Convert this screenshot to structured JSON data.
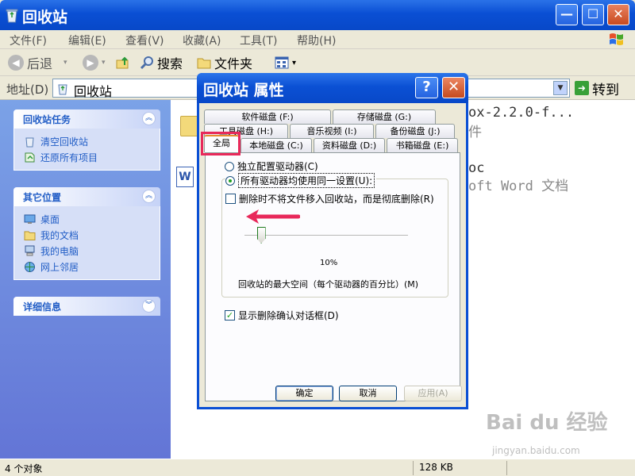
{
  "window": {
    "title": "回收站",
    "minimize": "—",
    "maximize": "☐",
    "close": "✕"
  },
  "menubar": {
    "items": [
      "文件(F)",
      "编辑(E)",
      "查看(V)",
      "收藏(A)",
      "工具(T)",
      "帮助(H)"
    ]
  },
  "toolbar": {
    "back": "后退",
    "search": "搜索",
    "folders": "文件夹",
    "view_arrow": "▾"
  },
  "address": {
    "label": "地址(D)",
    "value": "回收站",
    "go": "转到"
  },
  "sidebar": {
    "tasks_title": "回收站任务",
    "tasks": [
      "清空回收站",
      "还原所有项目"
    ],
    "places_title": "其它位置",
    "places": [
      "桌面",
      "我的文档",
      "我的电脑",
      "网上邻居"
    ],
    "details_title": "详细信息"
  },
  "content": {
    "file1_line1": "ox-2.2.0-f...",
    "file1_line2": "件",
    "file2_line1": "oc",
    "file2_line2": "oft Word 文档"
  },
  "status": {
    "count": "4 个对象",
    "size": "128 KB"
  },
  "dialog": {
    "title": "回收站 属性",
    "help": "?",
    "close": "✕",
    "tabs_row1": [
      "软件磁盘 (F:)",
      "存储磁盘 (G:)"
    ],
    "tabs_row2": [
      "工具磁盘 (H:)",
      "音乐视频 (I:)",
      "备份磁盘 (J:)"
    ],
    "tabs_row3": [
      "全局",
      "本地磁盘 (C:)",
      "资料磁盘 (D:)",
      "书箱磁盘 (E:)"
    ],
    "radio_independent": "独立配置驱动器(C)",
    "radio_same": "所有驱动器均使用同一设置(U):",
    "check_delete": "删除时不将文件移入回收站，而是彻底删除(R)",
    "check_delete_checked": false,
    "slider_percent": "10%",
    "slider_value": 10,
    "slider_caption": "回收站的最大空间（每个驱动器的百分比）(M)",
    "check_confirm": "显示删除确认对话框(D)",
    "check_confirm_checked": true,
    "btn_ok": "确定",
    "btn_cancel": "取消",
    "btn_apply": "应用(A)",
    "highlight_color": "#e8285a"
  },
  "watermark": {
    "text": "Bai du 经验",
    "sub": "jingyan.baidu.com"
  }
}
